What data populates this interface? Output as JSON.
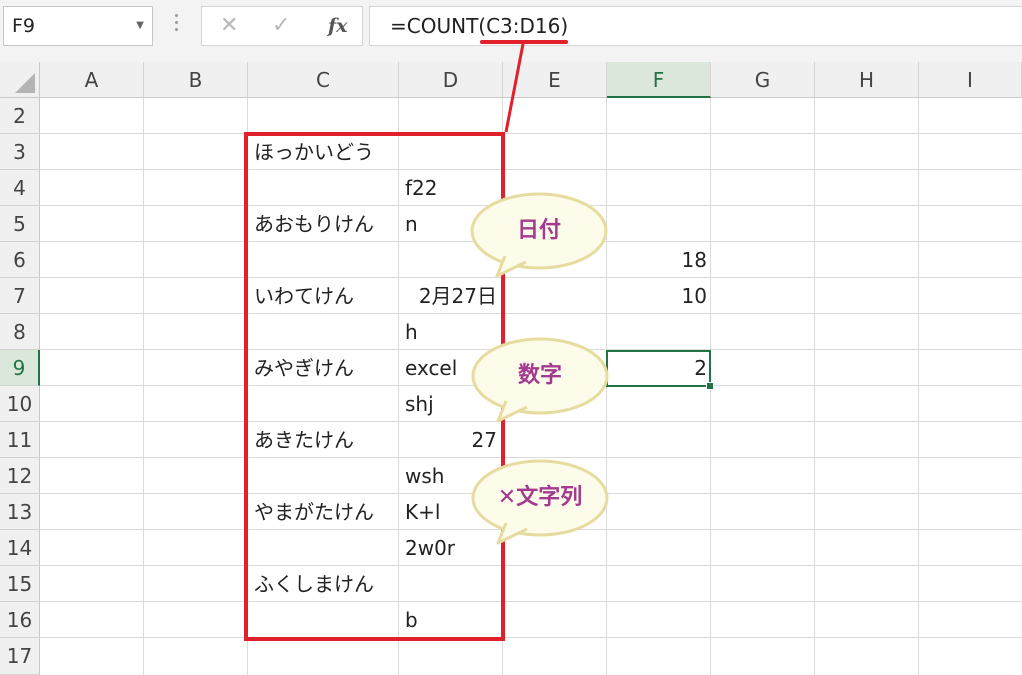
{
  "name_box": {
    "value": "F9"
  },
  "formula_bar": {
    "cancel_icon": "close-icon",
    "enter_icon": "check-icon",
    "function_label": "fx",
    "formula": "=COUNT(C3:D16)"
  },
  "columns": [
    "A",
    "B",
    "C",
    "D",
    "E",
    "F",
    "G",
    "H",
    "I"
  ],
  "selected_column": "F",
  "rows": [
    "2",
    "3",
    "4",
    "5",
    "6",
    "7",
    "8",
    "9",
    "10",
    "11",
    "12",
    "13",
    "14",
    "15",
    "16",
    "17"
  ],
  "selected_row": "9",
  "cells": {
    "C3": "ほっかいどう",
    "D4": "f22",
    "C5": "あおもりけん",
    "D5": "n",
    "F6": "18",
    "C7": "いわてけん",
    "D7": "2月27日",
    "F7": "10",
    "D8": "h",
    "C9": "みやぎけん",
    "D9": "excel",
    "F9": "2",
    "D10": "shj",
    "C11": "あきたけん",
    "D11": "27",
    "D12": "wsh",
    "C13": "やまがたけん",
    "D13": "K+l",
    "D14": "2w0r",
    "C15": "ふくしまけん",
    "D16": "b"
  },
  "annotations": {
    "bubble_date": "日付",
    "bubble_number": "数字",
    "bubble_string": "✕文字列"
  },
  "colors": {
    "highlight": "#e0202a",
    "bubble_fill": "#fdfbe9",
    "bubble_border": "#e6dca0",
    "bubble_text": "#a33a8f",
    "excel_green": "#217346"
  }
}
